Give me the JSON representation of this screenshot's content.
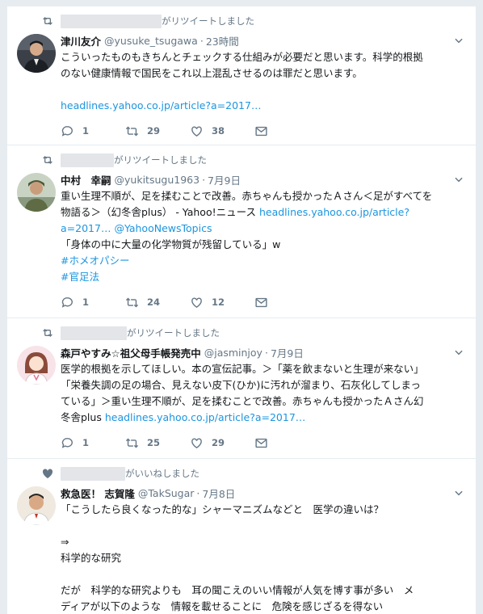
{
  "tweets": [
    {
      "context": "がリツイートしました",
      "context_icon": "retweet-icon",
      "fullname": "津川友介",
      "username": "@yusuke_tsugawa",
      "dot": "·",
      "timestamp": "23時間",
      "lines": [
        "こういったものもきちんとチェックする仕組みが必要だと思います。科学的根拠",
        "のない健康情報で国民をこれ以上混乱させるのは罪だと思います。",
        ""
      ],
      "link": "headlines.yahoo.co.jp/article?a=2017…",
      "replies": "1",
      "retweets": "29",
      "likes": "38"
    },
    {
      "context": "がリツイートしました",
      "context_icon": "retweet-icon",
      "fullname": "中村　幸嗣",
      "username": "@yukitsugu1963",
      "dot": "·",
      "timestamp": "7月9日",
      "line1": "重い生理不順が、足を揉むことで改善。赤ちゃんも授かったＡさん＜足がすべてを",
      "line2_prefix": "物語る＞（幻冬舎plus） - Yahoo!ニュース ",
      "line2_link": "headlines.yahoo.co.jp/article?",
      "line3_link": "a=2017…",
      "line3_mention": "@YahooNewsTopics",
      "line4": "「身体の中に大量の化学物質が残留している」w",
      "hashtag1": "#ホメオパシー",
      "hashtag2": "#官足法",
      "replies": "1",
      "retweets": "24",
      "likes": "12"
    },
    {
      "context": "がリツイートしました",
      "context_icon": "retweet-icon",
      "fullname": "森戸やすみ☆祖父母手帳発売中",
      "username": "@jasminjoy",
      "dot": "·",
      "timestamp": "7月9日",
      "lines": [
        "医学的根拠を示してほしい。本の宣伝記事。＞「薬を飲まないと生理が来ない」",
        "「栄養失調の足の場合、見えない皮下(ひか)に汚れが溜まり、石灰化してしまっ",
        "ている」＞重い生理不順が、足を揉むことで改善。赤ちゃんも授かったＡさん幻"
      ],
      "line4_prefix": "冬舎plus ",
      "line4_link": "headlines.yahoo.co.jp/article?a=2017…",
      "replies": "1",
      "retweets": "25",
      "likes": "29"
    },
    {
      "context": "がいいねしました",
      "context_icon": "heart-filled-icon",
      "fullname": "救急医！ 志賀隆",
      "username": "@TakSugar",
      "dot": "·",
      "timestamp": "7月8日",
      "lines": [
        "「こうしたら良くなった的な」シャーマニズムなどと　医学の違いは？",
        "",
        "⇒",
        "科学的な研究",
        "",
        "だが　科学的な研究よりも　耳の聞こえのいい情報が人気を博す事が多い　メ",
        "ディアが以下のような　情報を載せることに　危険を感じざるを得ない"
      ]
    }
  ],
  "colors": {
    "link": "#1b95e0",
    "muted": "#657786",
    "background": "#e6ecf0"
  }
}
